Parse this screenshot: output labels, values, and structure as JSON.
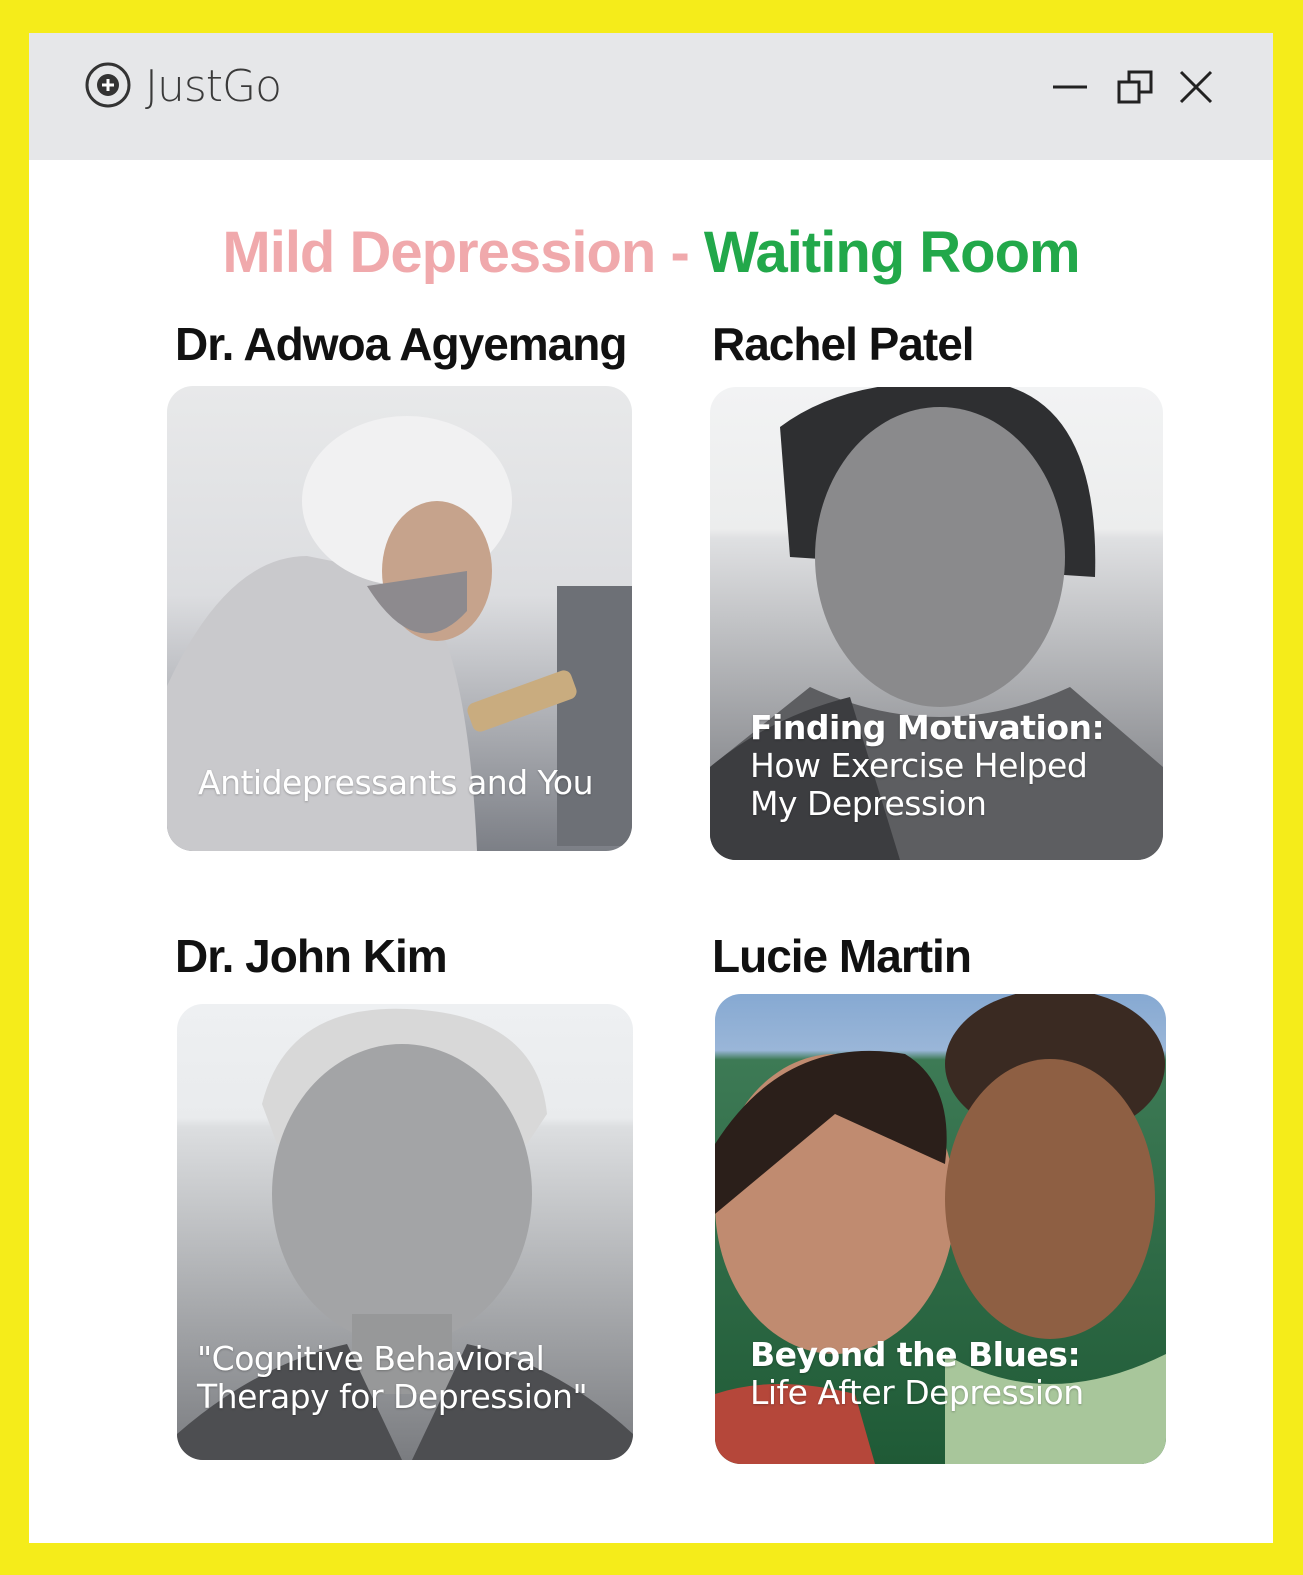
{
  "app": {
    "name": "JustGo"
  },
  "window_controls": {
    "minimize": "minimize",
    "restore": "restore",
    "close": "close"
  },
  "page": {
    "title_part1": "Mild Depression -",
    "title_part2": "Waiting Room",
    "title_colors": {
      "part1": "#f0a9ac",
      "part2": "#22a84a"
    }
  },
  "rooms": [
    {
      "name": "Dr. Adwoa Agyemang",
      "caption_bold": "",
      "caption_lines": [
        "Antidepressants and You"
      ]
    },
    {
      "name": "Rachel Patel",
      "caption_bold": "Finding Motivation:",
      "caption_lines": [
        "How Exercise Helped",
        "My Depression"
      ]
    },
    {
      "name": "Dr. John Kim",
      "caption_bold": "",
      "caption_lines": [
        "\"Cognitive Behavioral",
        "Therapy for Depression\""
      ]
    },
    {
      "name": "Lucie Martin",
      "caption_bold": "Beyond the Blues:",
      "caption_lines": [
        "Life After Depression"
      ]
    }
  ],
  "colors": {
    "frame": "#f5ec1a",
    "titlebar": "#e6e7e9"
  }
}
